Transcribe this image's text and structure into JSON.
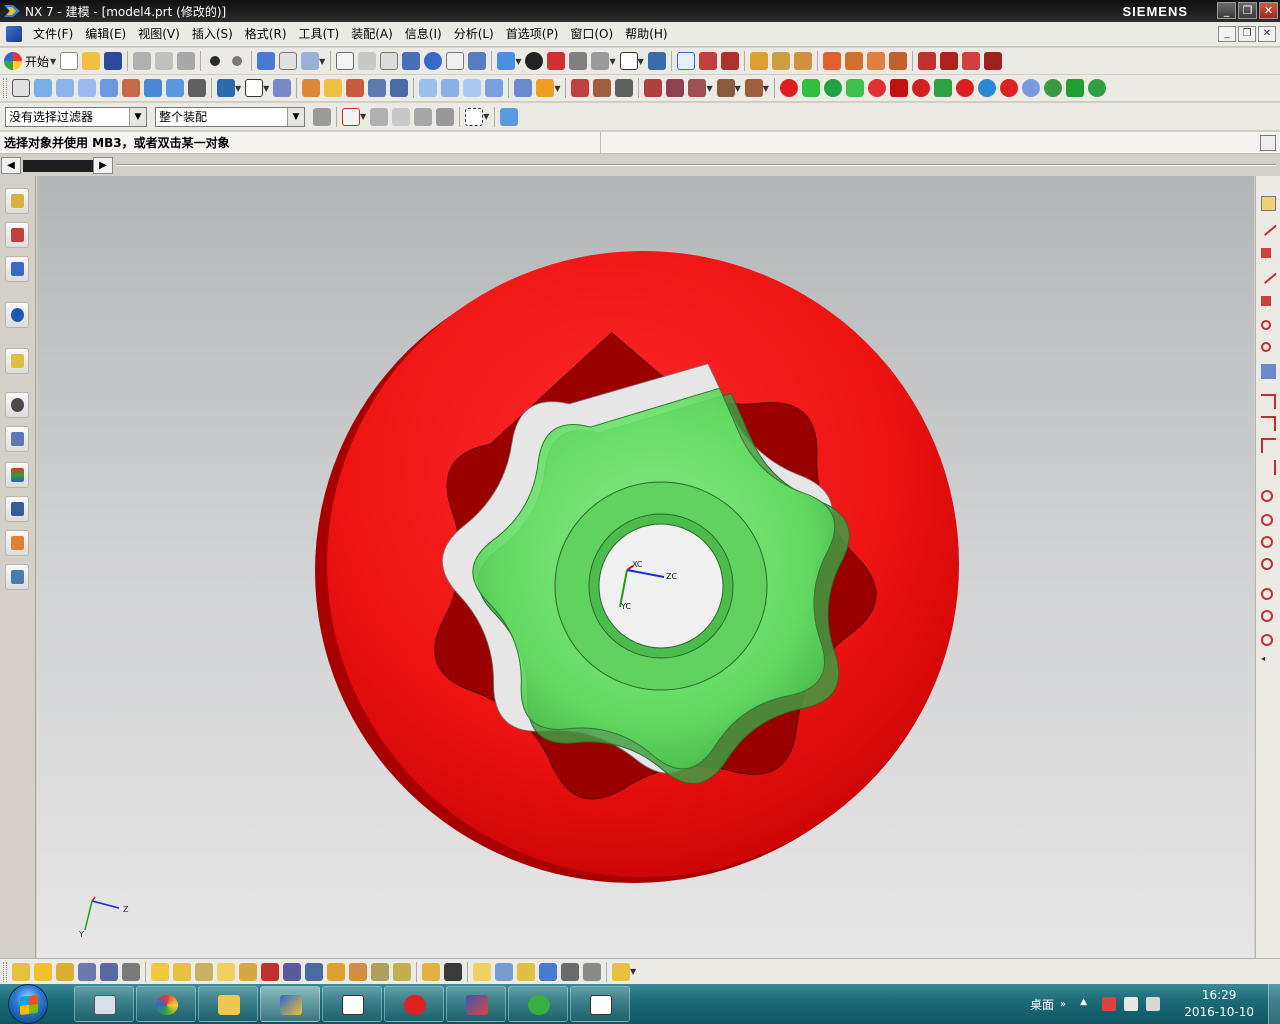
{
  "window": {
    "title": "NX 7 - 建模 - [model4.prt (修改的)]",
    "brand": "SIEMENS",
    "minimize": "_",
    "restore": "❐",
    "close": "✕"
  },
  "menubar": {
    "items": [
      "文件(F)",
      "编辑(E)",
      "视图(V)",
      "插入(S)",
      "格式(R)",
      "工具(T)",
      "装配(A)",
      "信息(I)",
      "分析(L)",
      "首选项(P)",
      "窗口(O)",
      "帮助(H)"
    ]
  },
  "toolbar": {
    "start_label": "开始",
    "filter_value": "没有选择过滤器",
    "scope_value": "整个装配"
  },
  "cue_line": {
    "text": "选择对象并使用 MB3，或者双击某一对象"
  },
  "viewport": {
    "wcs_labels": {
      "xc": "XC",
      "yc": "YC",
      "zc": "ZC"
    },
    "triad_labels": {
      "z": "Z",
      "y": "Y"
    },
    "colors": {
      "ring": "#e81010",
      "ring_dark": "#b00000",
      "gear": "#5ee65e",
      "gear_dark": "#3aaa3a"
    }
  },
  "taskbar": {
    "tray_label": "桌面",
    "time": "16:29",
    "date": "2016-10-10",
    "apps": [
      "calculator-icon",
      "paint-icon",
      "explorer-icon",
      "nx-icon",
      "ggg-icon",
      "g-app-icon",
      "ug-icon",
      "refresh-app-icon",
      "window-icon"
    ]
  }
}
